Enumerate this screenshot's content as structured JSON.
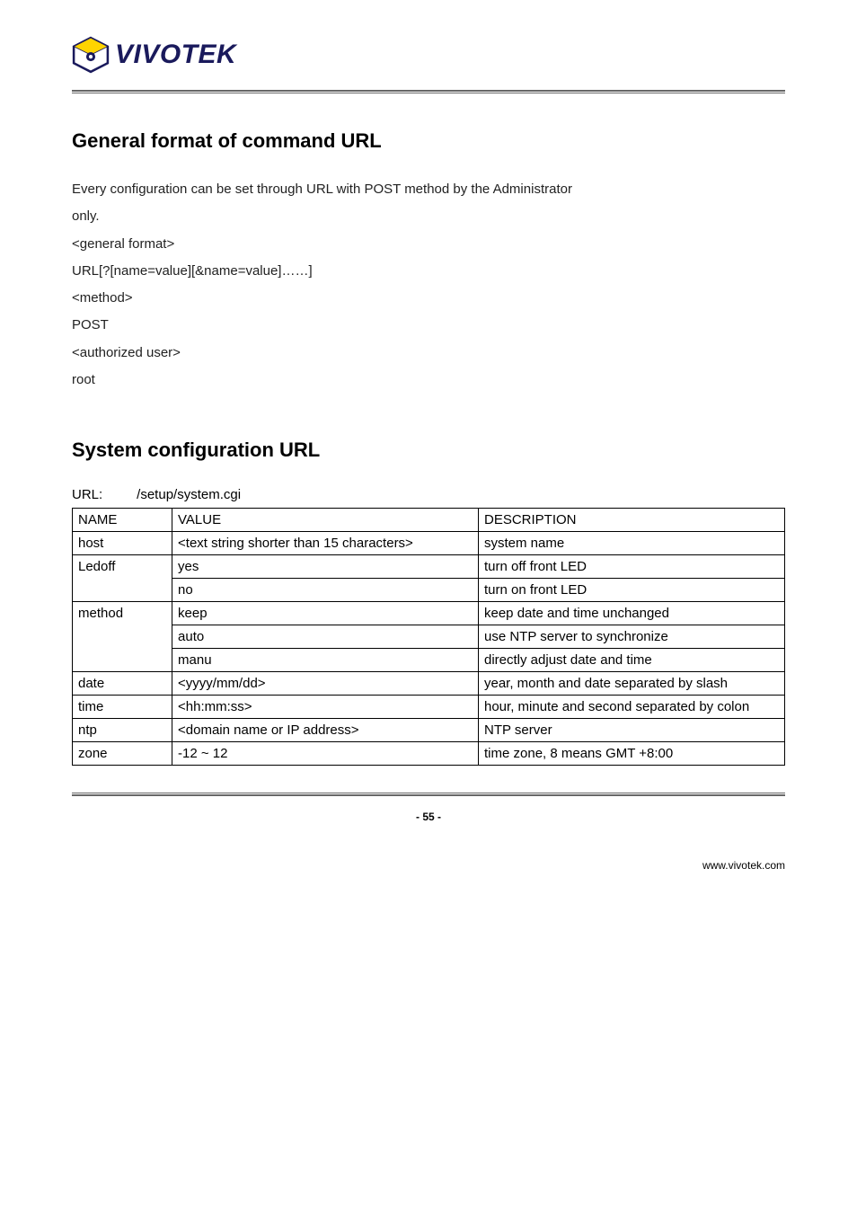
{
  "logo": {
    "text": "VIVOTEK"
  },
  "sections": {
    "general": {
      "heading": "General format of command URL",
      "intro1": "Every configuration can be set through URL with POST method by the Administrator",
      "intro2": "only.",
      "lines": [
        "<general format>",
        "URL[?[name=value][&name=value]……]",
        "<method>",
        "POST",
        "<authorized user>",
        "root"
      ]
    },
    "system": {
      "heading": "System configuration URL",
      "url_label": "URL:",
      "url_value": "/setup/system.cgi",
      "headers": [
        "NAME",
        "VALUE",
        "DESCRIPTION"
      ],
      "rows": [
        {
          "name": "host",
          "name_rowspan": 1,
          "value": "<text string shorter than 15 characters>",
          "desc": "system name"
        },
        {
          "name": "Ledoff",
          "name_rowspan": 2,
          "value": "yes",
          "desc": "turn off front LED"
        },
        {
          "value": "no",
          "desc": "turn on front LED"
        },
        {
          "name": "method",
          "name_rowspan": 3,
          "value": "keep",
          "desc": "keep date and time unchanged"
        },
        {
          "value": "auto",
          "desc": "use NTP server to synchronize"
        },
        {
          "value": "manu",
          "desc": "directly adjust date and time"
        },
        {
          "name": "date",
          "name_rowspan": 1,
          "value": "<yyyy/mm/dd>",
          "desc": "year, month and date separated by slash"
        },
        {
          "name": "time",
          "name_rowspan": 1,
          "value": "<hh:mm:ss>",
          "desc": "hour, minute and second separated by colon"
        },
        {
          "name": "ntp",
          "name_rowspan": 1,
          "value": "<domain name or IP address>",
          "desc": "NTP server"
        },
        {
          "name": "zone",
          "name_rowspan": 1,
          "value": "-12 ~ 12",
          "desc": "time zone, 8 means GMT +8:00"
        }
      ]
    }
  },
  "footer": {
    "page": "- 55 -",
    "url": "www.vivotek.com"
  }
}
